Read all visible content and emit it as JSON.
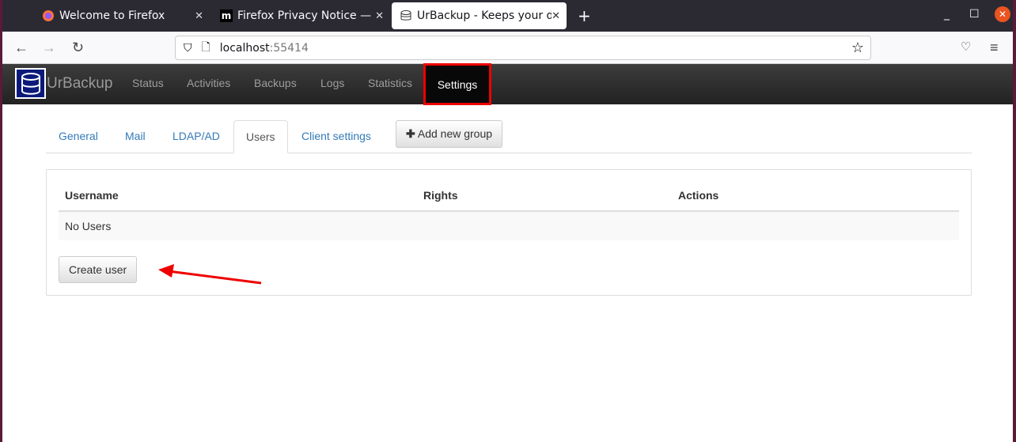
{
  "browser": {
    "tabs": [
      {
        "title": "Welcome to Firefox"
      },
      {
        "title": "Firefox Privacy Notice —"
      },
      {
        "title": "UrBackup - Keeps your da"
      }
    ],
    "url_host": "localhost",
    "url_port": ":55414"
  },
  "app": {
    "brand": "UrBackup",
    "nav": [
      "Status",
      "Activities",
      "Backups",
      "Logs",
      "Statistics",
      "Settings"
    ]
  },
  "settings": {
    "tabs": [
      "General",
      "Mail",
      "LDAP/AD",
      "Users",
      "Client settings"
    ],
    "add_group": "Add new group",
    "table": {
      "headers": [
        "Username",
        "Rights",
        "Actions"
      ],
      "empty": "No Users"
    },
    "create_user": "Create user"
  },
  "colors": {
    "highlight": "#ee0000",
    "link": "#337ab7"
  }
}
